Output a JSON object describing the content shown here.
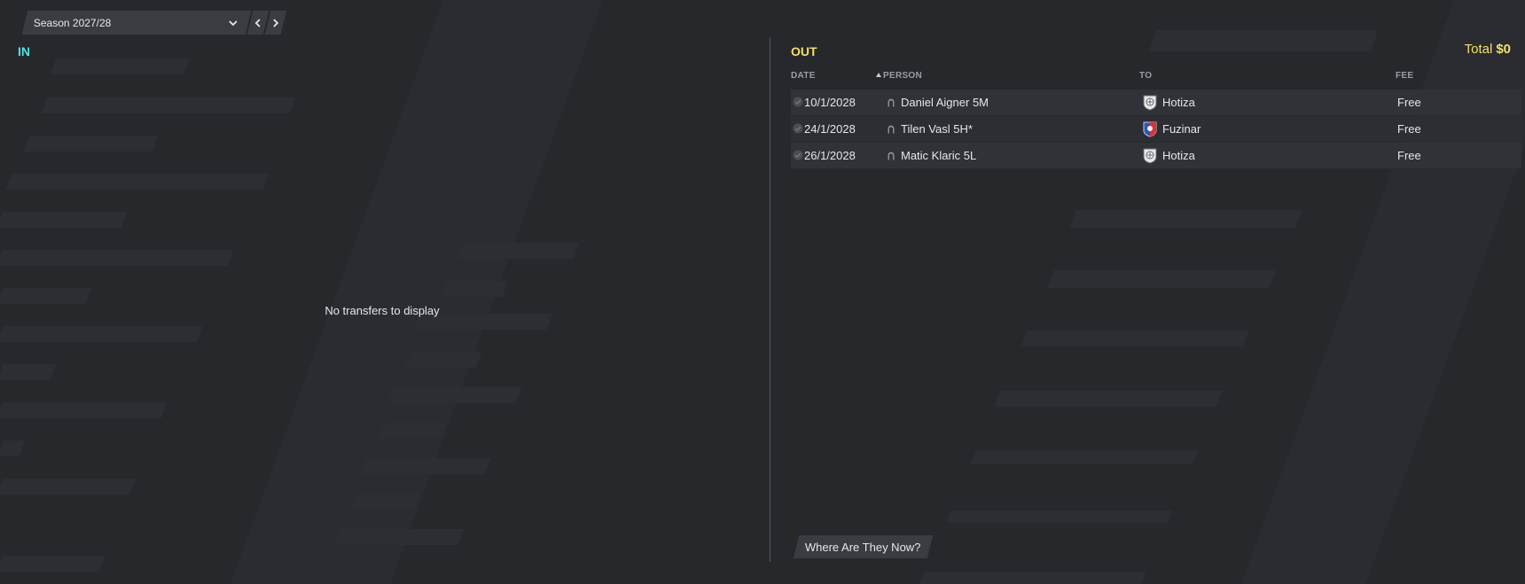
{
  "season": {
    "label": "Season 2027/28"
  },
  "panel_in": {
    "title": "IN",
    "empty_message": "No transfers to display"
  },
  "panel_out": {
    "title": "OUT",
    "total_label": "Total",
    "total_amount": "$0",
    "columns": {
      "date": "DATE",
      "person": "PERSON",
      "to": "TO",
      "fee": "FEE"
    },
    "rows": [
      {
        "date": "10/1/2028",
        "person": "Daniel Aigner 5M",
        "to": "Hotiza",
        "fee": "Free",
        "club_badge": "hotiza-badge"
      },
      {
        "date": "24/1/2028",
        "person": "Tilen Vasl 5H*",
        "to": "Fuzinar",
        "fee": "Free",
        "club_badge": "fuzinar-badge"
      },
      {
        "date": "26/1/2028",
        "person": "Matic Klaric 5L",
        "to": "Hotiza",
        "fee": "Free",
        "club_badge": "hotiza-badge"
      }
    ]
  },
  "actions": {
    "where_are_they_now": "Where Are They Now?"
  },
  "colors": {
    "background": "#26282c",
    "in_accent": "#4fe3e0",
    "out_accent": "#f4df6d"
  }
}
